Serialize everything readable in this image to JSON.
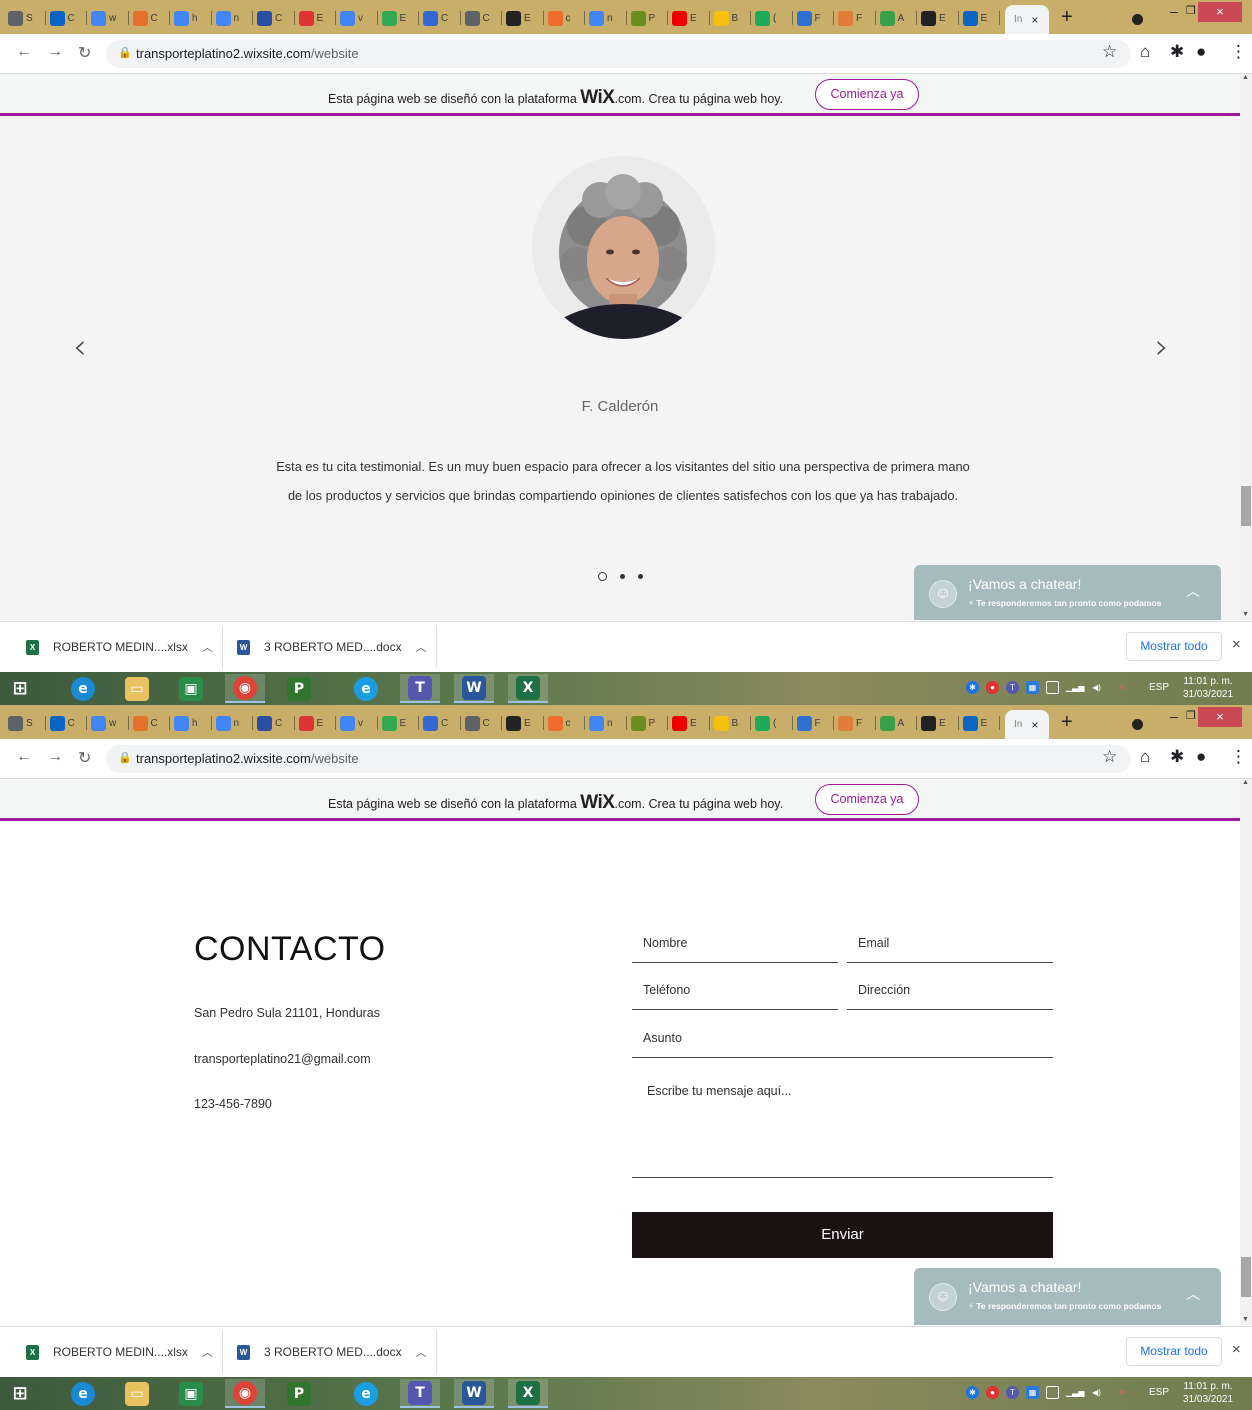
{
  "browser": {
    "tab_strip": [
      {
        "letter": "S",
        "icon": "chrome-icon",
        "color": "#5f6368"
      },
      {
        "letter": "C",
        "icon": "outlook-icon",
        "color": "#0a64c6"
      },
      {
        "letter": "w",
        "icon": "google-icon",
        "color": "#4285f4"
      },
      {
        "letter": "C",
        "icon": "tiktok-icon",
        "color": "#e6702e"
      },
      {
        "letter": "h",
        "icon": "google-icon",
        "color": "#4285f4"
      },
      {
        "letter": "n",
        "icon": "google-icon",
        "color": "#4285f4"
      },
      {
        "letter": "C",
        "icon": "chart-icon",
        "color": "#2b4fa0"
      },
      {
        "letter": "E",
        "icon": "flag-icon",
        "color": "#d33"
      },
      {
        "letter": "v",
        "icon": "google-icon",
        "color": "#4285f4"
      },
      {
        "letter": "E",
        "icon": "cloud-icon",
        "color": "#34a853"
      },
      {
        "letter": "C",
        "icon": "circle-c-icon",
        "color": "#3367d6"
      },
      {
        "letter": "C",
        "icon": "chrome-icon",
        "color": "#5f6368"
      },
      {
        "letter": "E",
        "icon": "l-icon",
        "color": "#222"
      },
      {
        "letter": "c",
        "icon": "orange-icon",
        "color": "#ef6c2e"
      },
      {
        "letter": "n",
        "icon": "google-icon",
        "color": "#4285f4"
      },
      {
        "letter": "P",
        "icon": "cash-icon",
        "color": "#6b8e23"
      },
      {
        "letter": "E",
        "icon": "youtube-icon",
        "color": "#e00"
      },
      {
        "letter": "B",
        "icon": "yellow-icon",
        "color": "#f4c20d"
      },
      {
        "letter": "(",
        "icon": "whatsapp-icon",
        "color": "#1faa59"
      },
      {
        "letter": "F",
        "icon": "s-icon",
        "color": "#2f6fd1"
      },
      {
        "letter": "F",
        "icon": "rainbow-icon",
        "color": "#e07b39"
      },
      {
        "letter": "A",
        "icon": "t-icon",
        "color": "#3aa04b"
      },
      {
        "letter": "E",
        "icon": "ct-icon",
        "color": "#222"
      },
      {
        "letter": "E",
        "icon": "linkedin-icon",
        "color": "#0a66c2"
      }
    ],
    "active_tab": {
      "label": "In",
      "close": "×"
    },
    "new_tab": "+",
    "url_host": "transporteplatino2.wixsite.com",
    "url_path": "/website",
    "window_min": "–",
    "window_restore": "❐",
    "window_close": "×"
  },
  "wix_banner": {
    "text_before": "Esta página web se diseñó con la plataforma",
    "logo": "WiX",
    "text_after": ".com. Crea tu página web hoy.",
    "button": "Comienza ya"
  },
  "testimonial": {
    "name": "F. Calderón",
    "quote": "Esta es tu cita testimonial. Es un muy buen espacio para ofrecer a los visitantes del sitio una perspectiva de primera mano de los productos y servicios que brindas compartiendo opiniones de clientes satisfechos con los que ya has trabajado.",
    "prev_arrow": "‹",
    "next_arrow": "›",
    "slides_total": 3,
    "slide_active": 1
  },
  "chat": {
    "title": "¡Vamos a chatear!",
    "subtitle": "⚡ Te responderemos tan pronto como podamos"
  },
  "contact": {
    "title": "CONTACTO",
    "address": "San Pedro Sula 21101, Honduras",
    "email": "transporteplatino21@gmail.com",
    "phone": "123-456-7890",
    "form": {
      "name": "Nombre",
      "email": "Email",
      "phone": "Teléfono",
      "address": "Dirección",
      "subject": "Asunto",
      "message": "Escribe tu mensaje aquí...",
      "submit": "Enviar"
    }
  },
  "downloads": {
    "items": [
      {
        "label": "ROBERTO MEDIN....xlsx",
        "icon": "excel-file-icon",
        "color": "#1e7145"
      },
      {
        "label": "3 ROBERTO MED....docx",
        "icon": "word-file-icon",
        "color": "#2b579a"
      }
    ],
    "show_all": "Mostrar todo",
    "close": "×"
  },
  "taskbar": {
    "language": "ESP",
    "time": "11:01 p. m.",
    "date": "31/03/2021"
  }
}
